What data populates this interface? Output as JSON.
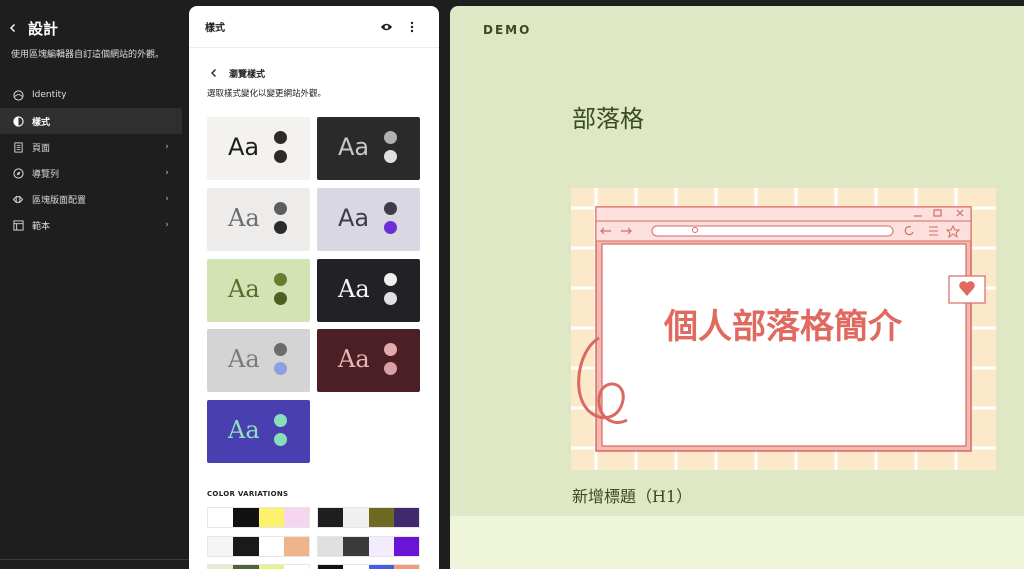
{
  "sidebar": {
    "title": "設計",
    "description": "使用區塊編輯器自訂這個網站的外觀。",
    "items": [
      {
        "label": "Identity",
        "icon": "identity-icon",
        "active": false,
        "chevron": false
      },
      {
        "label": "樣式",
        "icon": "styles-icon",
        "active": true,
        "chevron": false
      },
      {
        "label": "頁面",
        "icon": "page-icon",
        "active": false,
        "chevron": true
      },
      {
        "label": "導覽列",
        "icon": "navigation-icon",
        "active": false,
        "chevron": true
      },
      {
        "label": "區塊版面配置",
        "icon": "template-parts-icon",
        "active": false,
        "chevron": true
      },
      {
        "label": "範本",
        "icon": "layout-icon",
        "active": false,
        "chevron": true
      }
    ]
  },
  "panel": {
    "title": "樣式",
    "browse_title": "瀏覽樣式",
    "browse_desc": "選取樣式變化以變更網站外觀。",
    "styles": [
      {
        "bg": "#f3f2ee",
        "fg": "#1e1e1e",
        "dot1": "#2e2a26",
        "dot2": "#2e2a26",
        "serif": false
      },
      {
        "bg": "#2a2a2a",
        "fg": "#c8c8c8",
        "dot1": "#b0b0b0",
        "dot2": "#e0e0e0",
        "serif": false
      },
      {
        "bg": "#eeecea",
        "fg": "#6d6d6d",
        "dot1": "#5d5d5d",
        "dot2": "#2b2b2b",
        "serif": true
      },
      {
        "bg": "#d9d8e2",
        "fg": "#3d3d4a",
        "dot1": "#3b3b4a",
        "dot2": "#6a2fd6",
        "serif": false
      },
      {
        "bg": "#d3e3b4",
        "fg": "#5a6b2a",
        "dot1": "#6a7d2f",
        "dot2": "#4f5f22",
        "serif": true
      },
      {
        "bg": "#222226",
        "fg": "#f5f5f5",
        "dot1": "#f0f0f0",
        "dot2": "#e0e0e0",
        "serif": true
      },
      {
        "bg": "#d4d4d4",
        "fg": "#7b7b7b",
        "dot1": "#6b6b6b",
        "dot2": "#8ba0e0",
        "serif": true
      },
      {
        "bg": "#4a1f26",
        "fg": "#e8b4b8",
        "dot1": "#e5a9b0",
        "dot2": "#d8a0a6",
        "serif": true
      },
      {
        "bg": "#4a3fb0",
        "fg": "#8ee0c0",
        "dot1": "#86dfb8",
        "dot2": "#86dfb8",
        "serif": true
      }
    ],
    "style_aa": "Aa",
    "color_variations_label": "COLOR VARIATIONS",
    "color_variations": [
      [
        "#ffffff",
        "#111111",
        "#fdf26c",
        "#f4d6ef"
      ],
      [
        "#1e1e1e",
        "#f0f0f0",
        "#6e6a22",
        "#3f2a6b"
      ],
      [
        "#f5f5f5",
        "#1a1a1a",
        "#ffffff",
        "#efb48a"
      ],
      [
        "#e0e0e0",
        "#3a3a3a",
        "#f3ecfd",
        "#6a14d8"
      ],
      [
        "#e4ebd1",
        "#50623a",
        "#e6f28a",
        "#ffffff"
      ],
      [
        "#111111",
        "#ffffff",
        "#4a5ee0",
        "#f29a7a"
      ]
    ]
  },
  "preview": {
    "brand": "DEMO",
    "blog_title": "部落格",
    "image_caption": "個人部落格簡介",
    "heading": "新增標題（H1）"
  },
  "colors": {
    "accent": "#3b4a24",
    "pink": "#e06a60"
  }
}
